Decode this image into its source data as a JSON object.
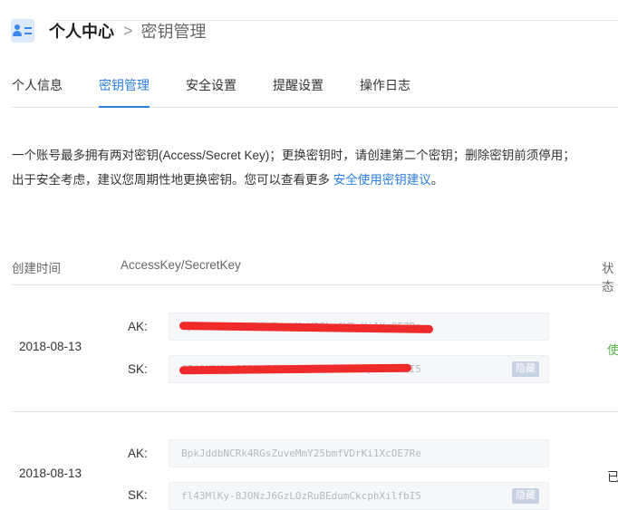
{
  "breadcrumb": {
    "root": "个人中心",
    "separator": ">",
    "current": "密钥管理"
  },
  "tabs": [
    {
      "label": "个人信息",
      "active": false
    },
    {
      "label": "密钥管理",
      "active": true
    },
    {
      "label": "安全设置",
      "active": false
    },
    {
      "label": "提醒设置",
      "active": false
    },
    {
      "label": "操作日志",
      "active": false
    }
  ],
  "notice": {
    "text": "一个账号最多拥有两对密钥(Access/Secret Key)；更换密钥时，请创建第二个密钥；删除密钥前须停用；出于安全考虑，建议您周期性地更换密钥。您可以查看更多 ",
    "link": "安全使用密钥建议",
    "end": "。"
  },
  "table": {
    "headers": {
      "created": "创建时间",
      "keys": "AccessKey/SecretKey",
      "status": "状态"
    },
    "rows": [
      {
        "date": "2018-08-13",
        "ak_label": "AK:",
        "ak": "BpkJddbNCRk4RGsZuveMmY25bmfVDrKi1XcOE7Re",
        "sk_label": "SK:",
        "sk": "fI43MlKy-8JONzJ6GzLOzRuBEdumCkcphXilfbI5",
        "hide_label": "隐藏",
        "status": "使"
      },
      {
        "date": "2018-08-13",
        "ak_label": "AK:",
        "ak": "BpkJddbNCRk4RGsZuveMmY25bmfVDrKi1XcOE7Re",
        "sk_label": "SK:",
        "sk": "fl43MlKy-8JONzJ6GzLOzRuBEdumCkcphXilfbI5",
        "hide_label": "隐藏",
        "status": "已"
      }
    ]
  },
  "colors": {
    "accent": "#2d7fe0",
    "status_active": "#5bb04a",
    "redaction": "#ee2a2a"
  },
  "icons": {
    "logo": "user-card-icon"
  }
}
